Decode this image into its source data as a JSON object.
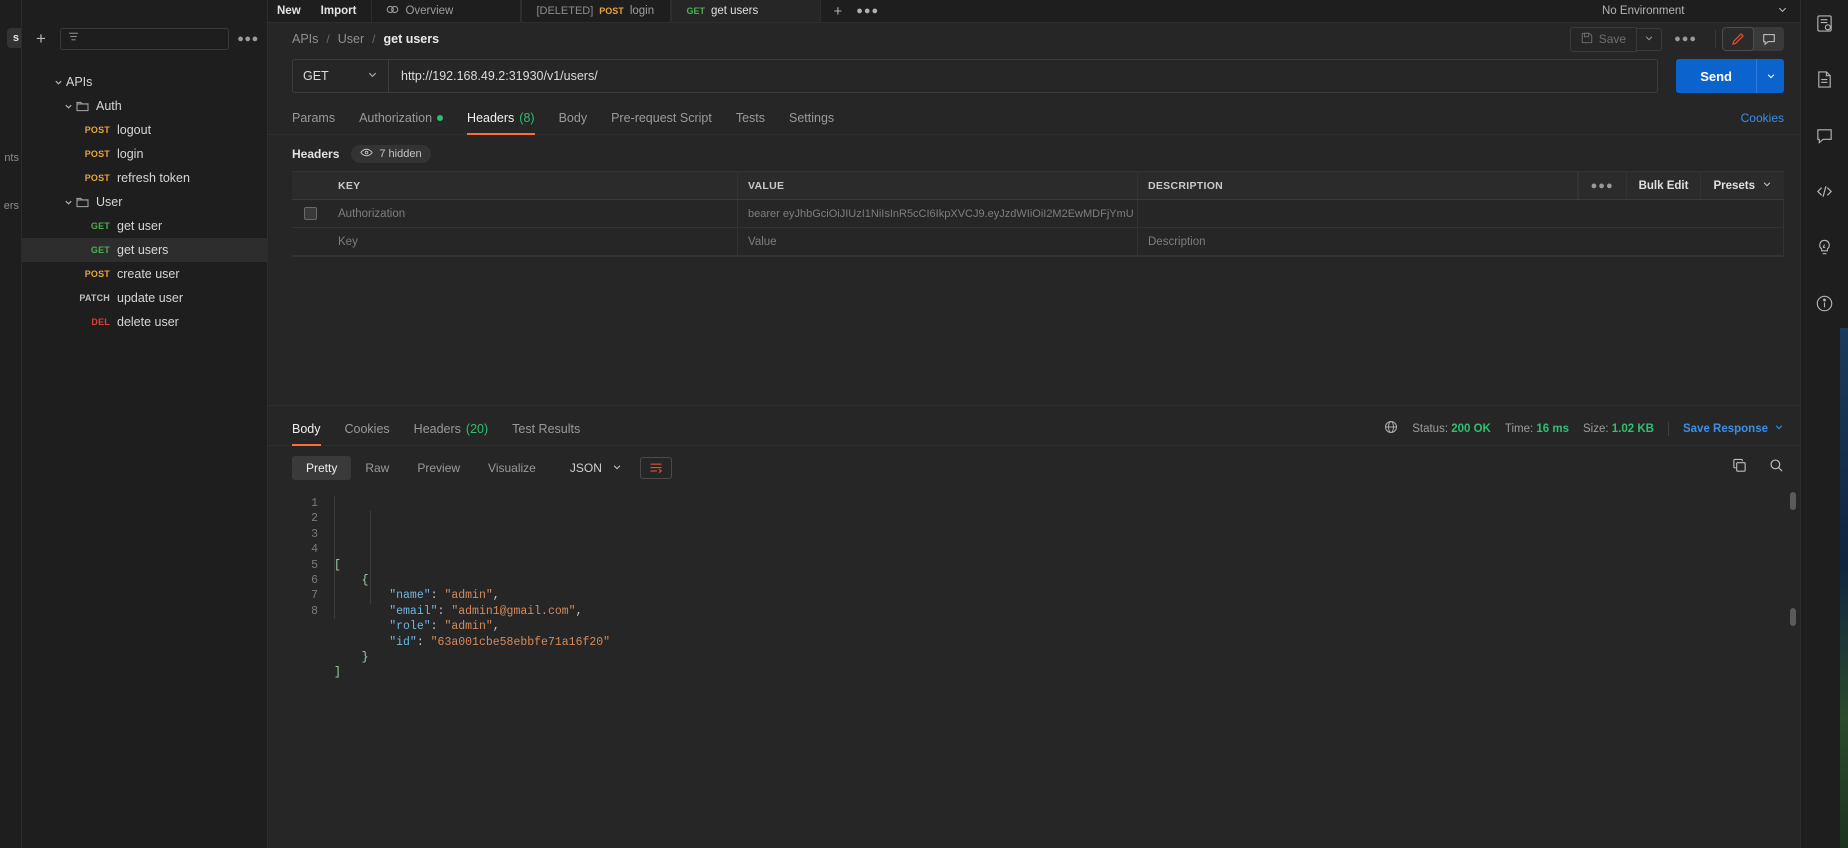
{
  "rail_left": {
    "items": [
      {
        "label": "Collections",
        "clipped": "s",
        "active": true
      },
      {
        "label": "Environments",
        "clipped": "nts",
        "active": false
      },
      {
        "label": "Mock Servers",
        "clipped": "ers",
        "active": false
      }
    ]
  },
  "sidebar": {
    "new_label": "New",
    "import_label": "Import",
    "add_icon": "plus-icon",
    "filter_icon": "filter-icon",
    "more_icon": "more-options-icon",
    "tree": [
      {
        "label": "APIs",
        "type": "root",
        "depth": 0,
        "expanded": true,
        "method": null
      },
      {
        "label": "Auth",
        "type": "folder",
        "depth": 1,
        "expanded": true,
        "method": null
      },
      {
        "label": "logout",
        "type": "request",
        "depth": 2,
        "method": "POST"
      },
      {
        "label": "login",
        "type": "request",
        "depth": 2,
        "method": "POST"
      },
      {
        "label": "refresh token",
        "type": "request",
        "depth": 2,
        "method": "POST"
      },
      {
        "label": "User",
        "type": "folder",
        "depth": 1,
        "expanded": true,
        "method": null
      },
      {
        "label": "get user",
        "type": "request",
        "depth": 2,
        "method": "GET"
      },
      {
        "label": "get users",
        "type": "request",
        "depth": 2,
        "method": "GET",
        "selected": true
      },
      {
        "label": "create user",
        "type": "request",
        "depth": 2,
        "method": "POST"
      },
      {
        "label": "update user",
        "type": "request",
        "depth": 2,
        "method": "PATCH"
      },
      {
        "label": "delete user",
        "type": "request",
        "depth": 2,
        "method": "DEL"
      }
    ]
  },
  "tabbar": {
    "tabs": [
      {
        "label": "Overview",
        "icon": "overview-icon",
        "method": null,
        "prefix": null,
        "active": false
      },
      {
        "label": "login",
        "icon": null,
        "method": "POST",
        "prefix": "[DELETED]",
        "active": false
      },
      {
        "label": "get users",
        "icon": null,
        "method": "GET",
        "prefix": null,
        "active": true
      }
    ],
    "add_tab_icon": "plus-icon",
    "tab_options_icon": "more-options-icon",
    "environment": "No Environment",
    "environment_caret": "chevron-down-icon"
  },
  "breadcrumb": {
    "parts": [
      "APIs",
      "User",
      "get users"
    ],
    "separator": "/",
    "save_label": "Save",
    "save_icon": "save-disk-icon",
    "save_caret_icon": "chevron-down-icon",
    "more_icon": "more-options-icon",
    "edit_icon": "pencil-icon",
    "comment_icon": "comment-icon"
  },
  "request": {
    "method": "GET",
    "method_caret": "chevron-down-icon",
    "url": "http://192.168.49.2:31930/v1/users/",
    "send_label": "Send",
    "send_caret_icon": "chevron-down-icon",
    "tabs": [
      {
        "label": "Params",
        "active": false,
        "count": null,
        "dot": false
      },
      {
        "label": "Authorization",
        "active": false,
        "count": null,
        "dot": true
      },
      {
        "label": "Headers",
        "active": true,
        "count": "(8)",
        "dot": false
      },
      {
        "label": "Body",
        "active": false,
        "count": null,
        "dot": false
      },
      {
        "label": "Pre-request Script",
        "active": false,
        "count": null,
        "dot": false
      },
      {
        "label": "Tests",
        "active": false,
        "count": null,
        "dot": false
      },
      {
        "label": "Settings",
        "active": false,
        "count": null,
        "dot": false
      }
    ],
    "cookies_link": "Cookies"
  },
  "headers_section": {
    "title": "Headers",
    "hidden_label": "7 hidden",
    "hidden_icon": "eye-icon",
    "columns": [
      "KEY",
      "VALUE",
      "DESCRIPTION"
    ],
    "actions": {
      "more_icon": "more-options-icon",
      "bulk_edit": "Bulk Edit",
      "presets": "Presets",
      "presets_caret": "chevron-down-icon"
    },
    "rows": [
      {
        "checked": false,
        "key": "Authorization",
        "value": "bearer eyJhbGciOiJIUzI1NiIsInR5cCI6IkpXVCJ9.eyJzdWIiOiI2M2EwMDFjYmU",
        "description": "",
        "placeholder": false
      },
      {
        "checked": false,
        "key": "Key",
        "value": "Value",
        "description": "Description",
        "placeholder": true
      }
    ]
  },
  "response": {
    "tabs": [
      {
        "label": "Body",
        "active": true,
        "count": null
      },
      {
        "label": "Cookies",
        "active": false,
        "count": null
      },
      {
        "label": "Headers",
        "active": false,
        "count": "(20)"
      },
      {
        "label": "Test Results",
        "active": false,
        "count": null
      }
    ],
    "meta": {
      "globe_icon": "globe-icon",
      "status_label": "Status:",
      "status_value": "200 OK",
      "time_label": "Time:",
      "time_value": "16 ms",
      "size_label": "Size:",
      "size_value": "1.02 KB",
      "save_response": "Save Response",
      "save_response_caret": "chevron-down-icon"
    },
    "format_tabs": [
      {
        "label": "Pretty",
        "active": true
      },
      {
        "label": "Raw",
        "active": false
      },
      {
        "label": "Preview",
        "active": false
      },
      {
        "label": "Visualize",
        "active": false
      }
    ],
    "language": "JSON",
    "language_caret": "chevron-down-icon",
    "wrap_icon": "wrap-lines-icon",
    "copy_icon": "copy-icon",
    "search_icon": "search-icon",
    "body_lines": [
      {
        "n": "1",
        "tokens": [
          {
            "t": "[",
            "c": "brk"
          }
        ]
      },
      {
        "n": "2",
        "tokens": [
          {
            "t": "    {",
            "c": "brk"
          }
        ]
      },
      {
        "n": "3",
        "tokens": [
          {
            "t": "        ",
            "c": "pun"
          },
          {
            "t": "\"name\"",
            "c": "key"
          },
          {
            "t": ": ",
            "c": "pun"
          },
          {
            "t": "\"admin\"",
            "c": "str"
          },
          {
            "t": ",",
            "c": "pun"
          }
        ]
      },
      {
        "n": "4",
        "tokens": [
          {
            "t": "        ",
            "c": "pun"
          },
          {
            "t": "\"email\"",
            "c": "key"
          },
          {
            "t": ": ",
            "c": "pun"
          },
          {
            "t": "\"admin1@gmail.com\"",
            "c": "str"
          },
          {
            "t": ",",
            "c": "pun"
          }
        ]
      },
      {
        "n": "5",
        "tokens": [
          {
            "t": "        ",
            "c": "pun"
          },
          {
            "t": "\"role\"",
            "c": "key"
          },
          {
            "t": ": ",
            "c": "pun"
          },
          {
            "t": "\"admin\"",
            "c": "str"
          },
          {
            "t": ",",
            "c": "pun"
          }
        ]
      },
      {
        "n": "6",
        "tokens": [
          {
            "t": "        ",
            "c": "pun"
          },
          {
            "t": "\"id\"",
            "c": "key"
          },
          {
            "t": ": ",
            "c": "pun"
          },
          {
            "t": "\"63a001cbe58ebbfe71a16f20\"",
            "c": "str"
          }
        ]
      },
      {
        "n": "7",
        "tokens": [
          {
            "t": "    }",
            "c": "brk"
          }
        ]
      },
      {
        "n": "8",
        "tokens": [
          {
            "t": "]",
            "c": "brk"
          }
        ]
      }
    ]
  },
  "rail_right": {
    "icons": [
      "environment-quick-look-icon",
      "documentation-icon",
      "comments-icon",
      "code-snippet-icon",
      "mock-lightbulb-icon",
      "info-icon"
    ]
  },
  "colors": {
    "accent": "#ff6c37",
    "send": "#0b63ce",
    "link": "#3b8fe8",
    "success": "#2fbf71",
    "post": "#e8a33d",
    "get": "#4caf50",
    "delete": "#e03b3b"
  }
}
